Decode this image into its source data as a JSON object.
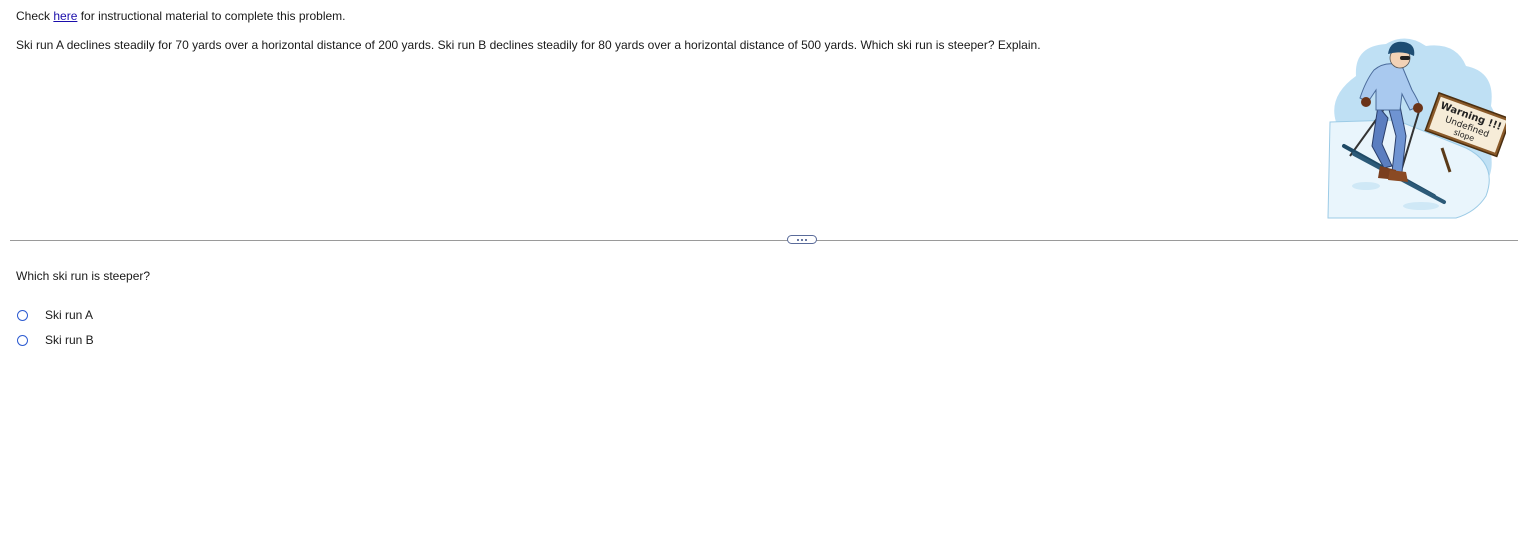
{
  "instructions": {
    "prefix": "Check ",
    "link_label": "here",
    "suffix": " for instructional material to complete this problem."
  },
  "problem": {
    "text": "Ski run A declines steadily for 70 yards over a horizontal distance of 200 yards. Ski run B declines steadily for 80 yards over a horizontal distance of 500 yards. Which ski run is steeper? Explain."
  },
  "illustration": {
    "sign_line1": "Warning !!!",
    "sign_line2": "Undefined",
    "sign_line3": "slope"
  },
  "question": {
    "prompt": "Which ski run is steeper?",
    "options": [
      {
        "label": "Ski run A"
      },
      {
        "label": "Ski run B"
      }
    ]
  },
  "colors": {
    "link": "#1a0dab",
    "radio_border": "#2d5bd1",
    "divider": "#9a9a9a"
  }
}
